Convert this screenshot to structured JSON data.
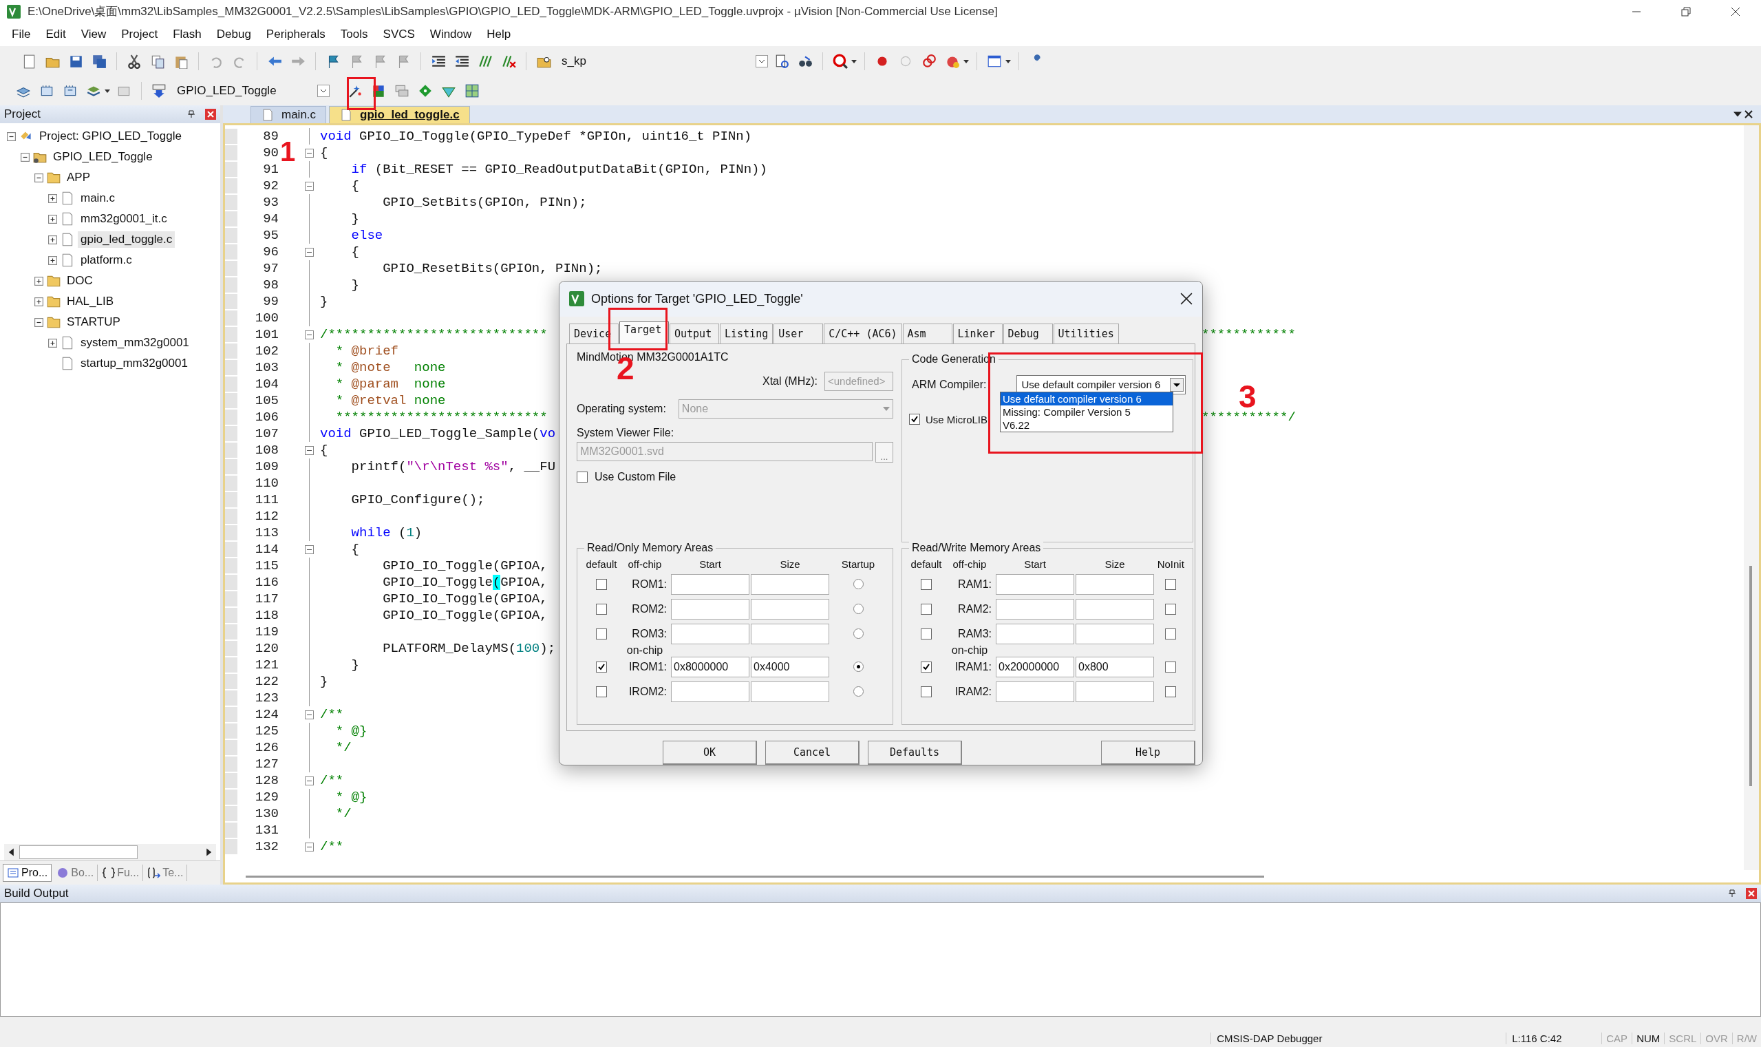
{
  "window": {
    "title": "E:\\OneDrive\\桌面\\mm32\\LibSamples_MM32G0001_V2.2.5\\Samples\\LibSamples\\GPIO\\GPIO_LED_Toggle\\MDK-ARM\\GPIO_LED_Toggle.uvprojx - µVision  [Non-Commercial Use License]"
  },
  "menu": [
    "File",
    "Edit",
    "View",
    "Project",
    "Flash",
    "Debug",
    "Peripherals",
    "Tools",
    "SVCS",
    "Window",
    "Help"
  ],
  "toolbar": {
    "find_combo": "s_kp",
    "target_combo": "GPIO_LED_Toggle"
  },
  "project_panel": {
    "title": "Project",
    "tree": [
      {
        "label": "Project: GPIO_LED_Toggle",
        "kind": "project",
        "expanded": true,
        "selected": false,
        "children": [
          {
            "label": "GPIO_LED_Toggle",
            "kind": "target",
            "expanded": true,
            "selected": false,
            "children": [
              {
                "label": "APP",
                "kind": "folder",
                "expanded": true,
                "selected": false,
                "children": [
                  {
                    "label": "main.c",
                    "kind": "file",
                    "expanded": false,
                    "selected": false
                  },
                  {
                    "label": "mm32g0001_it.c",
                    "kind": "file",
                    "expanded": false,
                    "selected": false
                  },
                  {
                    "label": "gpio_led_toggle.c",
                    "kind": "file",
                    "expanded": false,
                    "selected": true
                  },
                  {
                    "label": "platform.c",
                    "kind": "file",
                    "expanded": false,
                    "selected": false
                  }
                ]
              },
              {
                "label": "DOC",
                "kind": "folder",
                "expanded": false,
                "selected": false
              },
              {
                "label": "HAL_LIB",
                "kind": "folder",
                "expanded": false,
                "selected": false
              },
              {
                "label": "STARTUP",
                "kind": "folder",
                "expanded": true,
                "selected": false,
                "children": [
                  {
                    "label": "system_mm32g0001",
                    "kind": "file",
                    "expanded": false,
                    "selected": false
                  },
                  {
                    "label": "startup_mm32g0001",
                    "kind": "file",
                    "selected": false
                  }
                ]
              }
            ]
          }
        ]
      }
    ],
    "tabs": [
      {
        "label": "Pro...",
        "selected": true
      },
      {
        "label": "Bo...",
        "selected": false
      },
      {
        "label": "Fu...",
        "selected": false
      },
      {
        "label": "Te...",
        "selected": false
      }
    ]
  },
  "editor": {
    "tabs": [
      {
        "label": "main.c",
        "selected": false
      },
      {
        "label": "gpio_led_toggle.c",
        "selected": true
      }
    ],
    "lines": [
      {
        "number": "89",
        "fold": false,
        "tokens": [
          {
            "kind": "keyword",
            "text": "void"
          },
          {
            "text": " GPIO_IO_Toggle(GPIO_TypeDef *GPIOn, uint16_t PINn)"
          }
        ]
      },
      {
        "number": "90",
        "fold": true,
        "tokens": [
          {
            "text": "{"
          }
        ]
      },
      {
        "number": "91",
        "fold": false,
        "tokens": [
          {
            "kind": "keyword",
            "text": "    if"
          },
          {
            "text": " (Bit_RESET == GPIO_ReadOutputDataBit(GPIOn, PINn))"
          }
        ]
      },
      {
        "number": "92",
        "fold": true,
        "tokens": [
          {
            "text": "    {"
          }
        ]
      },
      {
        "number": "93",
        "fold": false,
        "tokens": [
          {
            "text": "        GPIO_SetBits(GPIOn, PINn);"
          }
        ]
      },
      {
        "number": "94",
        "fold": false,
        "tokens": [
          {
            "text": "    }"
          }
        ]
      },
      {
        "number": "95",
        "fold": false,
        "tokens": [
          {
            "kind": "keyword",
            "text": "    else"
          }
        ]
      },
      {
        "number": "96",
        "fold": true,
        "tokens": [
          {
            "text": "    {"
          }
        ]
      },
      {
        "number": "97",
        "fold": false,
        "tokens": [
          {
            "text": "        GPIO_ResetBits(GPIOn, PINn);"
          }
        ]
      },
      {
        "number": "98",
        "fold": false,
        "tokens": [
          {
            "text": "    }"
          }
        ]
      },
      {
        "number": "99",
        "fold": false,
        "tokens": [
          {
            "text": "}"
          }
        ]
      },
      {
        "number": "100",
        "fold": false
      },
      {
        "number": "101",
        "fold": true,
        "tokens": [
          {
            "kind": "comment",
            "text": "/****************************"
          }
        ],
        "tail": "************"
      },
      {
        "number": "102",
        "fold": false,
        "tokens": [
          {
            "kind": "comment",
            "text": "  * "
          },
          {
            "kind": "tag",
            "text": "@brief"
          }
        ]
      },
      {
        "number": "103",
        "fold": false,
        "tokens": [
          {
            "kind": "comment",
            "text": "  * "
          },
          {
            "kind": "tag",
            "text": "@note"
          },
          {
            "kind": "comment",
            "text": "   none"
          }
        ]
      },
      {
        "number": "104",
        "fold": false,
        "tokens": [
          {
            "kind": "comment",
            "text": "  * "
          },
          {
            "kind": "tag",
            "text": "@param"
          },
          {
            "kind": "comment",
            "text": "  none"
          }
        ]
      },
      {
        "number": "105",
        "fold": false,
        "tokens": [
          {
            "kind": "comment",
            "text": "  * "
          },
          {
            "kind": "tag",
            "text": "@retval"
          },
          {
            "kind": "comment",
            "text": " none"
          }
        ]
      },
      {
        "number": "106",
        "fold": false,
        "tokens": [
          {
            "kind": "comment",
            "text": "  ***************************"
          }
        ],
        "tail": "***********/"
      },
      {
        "number": "107",
        "fold": false,
        "tokens": [
          {
            "kind": "keyword",
            "text": "void"
          },
          {
            "text": " GPIO_LED_Toggle_Sample("
          },
          {
            "kind": "keyword",
            "text": "vo"
          }
        ]
      },
      {
        "number": "108",
        "fold": true,
        "tokens": [
          {
            "text": "{"
          }
        ]
      },
      {
        "number": "109",
        "fold": false,
        "tokens": [
          {
            "text": "    printf("
          },
          {
            "kind": "string",
            "text": "\"\\r\\nTest %s\""
          },
          {
            "text": ", __FU"
          }
        ]
      },
      {
        "number": "110",
        "fold": false
      },
      {
        "number": "111",
        "fold": false,
        "tokens": [
          {
            "text": "    GPIO_Configure();"
          }
        ]
      },
      {
        "number": "112",
        "fold": false
      },
      {
        "number": "113",
        "fold": false,
        "tokens": [
          {
            "kind": "keyword",
            "text": "    while"
          },
          {
            "text": " ("
          },
          {
            "kind": "number",
            "text": "1"
          },
          {
            "text": ")"
          }
        ]
      },
      {
        "number": "114",
        "fold": true,
        "tokens": [
          {
            "text": "    {"
          }
        ]
      },
      {
        "number": "115",
        "fold": false,
        "tokens": [
          {
            "text": "        GPIO_IO_Toggle(GPIOA,"
          }
        ]
      },
      {
        "number": "116",
        "fold": false,
        "tokens": [
          {
            "text": "        GPIO_IO_Toggle"
          },
          {
            "kind": "match",
            "text": "("
          },
          {
            "text": "GPIOA,"
          }
        ]
      },
      {
        "number": "117",
        "fold": false,
        "tokens": [
          {
            "text": "        GPIO_IO_Toggle(GPIOA,"
          }
        ]
      },
      {
        "number": "118",
        "fold": false,
        "tokens": [
          {
            "text": "        GPIO_IO_Toggle(GPIOA,"
          }
        ]
      },
      {
        "number": "119",
        "fold": false
      },
      {
        "number": "120",
        "fold": false,
        "tokens": [
          {
            "text": "        PLATFORM_DelayMS("
          },
          {
            "kind": "number",
            "text": "100"
          },
          {
            "text": ");"
          }
        ]
      },
      {
        "number": "121",
        "fold": false,
        "tokens": [
          {
            "text": "    }"
          }
        ]
      },
      {
        "number": "122",
        "fold": false,
        "tokens": [
          {
            "text": "}"
          }
        ]
      },
      {
        "number": "123",
        "fold": false
      },
      {
        "number": "124",
        "fold": true,
        "tokens": [
          {
            "kind": "comment",
            "text": "/**"
          }
        ]
      },
      {
        "number": "125",
        "fold": false,
        "tokens": [
          {
            "kind": "comment",
            "text": "  * @}"
          }
        ]
      },
      {
        "number": "126",
        "fold": false,
        "tokens": [
          {
            "kind": "comment",
            "text": "  */"
          }
        ]
      },
      {
        "number": "127",
        "fold": false
      },
      {
        "number": "128",
        "fold": true,
        "tokens": [
          {
            "kind": "comment",
            "text": "/**"
          }
        ]
      },
      {
        "number": "129",
        "fold": false,
        "tokens": [
          {
            "kind": "comment",
            "text": "  * @}"
          }
        ]
      },
      {
        "number": "130",
        "fold": false,
        "tokens": [
          {
            "kind": "comment",
            "text": "  */"
          }
        ]
      },
      {
        "number": "131",
        "fold": false
      },
      {
        "number": "132",
        "fold": true,
        "tokens": [
          {
            "kind": "comment",
            "text": "/**"
          }
        ]
      }
    ]
  },
  "dialog": {
    "title": "Options for Target 'GPIO_LED_Toggle'",
    "tabs": [
      {
        "label": "Device",
        "selected": false
      },
      {
        "label": "Target",
        "selected": true
      },
      {
        "label": "Output",
        "selected": false
      },
      {
        "label": "Listing",
        "selected": false
      },
      {
        "label": "User",
        "selected": false
      },
      {
        "label": "C/C++ (AC6)",
        "selected": false
      },
      {
        "label": "Asm",
        "selected": false
      },
      {
        "label": "Linker",
        "selected": false
      },
      {
        "label": "Debug",
        "selected": false
      },
      {
        "label": "Utilities",
        "selected": false
      }
    ],
    "device": "MindMotion MM32G0001A1TC",
    "xtal": {
      "label": "Xtal (MHz):",
      "value": "<undefined>"
    },
    "os": {
      "label": "Operating system:",
      "value": "None"
    },
    "svd": {
      "label": "System Viewer File:",
      "value": "MM32G0001.svd",
      "browse": "..."
    },
    "custom_file": {
      "label": "Use Custom File",
      "checked": false
    },
    "code_gen": {
      "title": "Code Generation",
      "compiler_label": "ARM Compiler:",
      "compiler_value": "Use default compiler version 6",
      "options": [
        {
          "label": "Use default compiler version 6",
          "selected": true
        },
        {
          "label": "Missing: Compiler Version 5",
          "selected": false
        },
        {
          "label": "V6.22",
          "selected": false
        }
      ],
      "microlib": {
        "label": "Use MicroLIB",
        "checked": true
      }
    },
    "rom": {
      "title": "Read/Only Memory Areas",
      "headers": [
        "default",
        "off-chip",
        "Start",
        "Size",
        "Startup"
      ],
      "rows": [
        {
          "kind": "area",
          "label": "ROM1:",
          "default": false,
          "option": false
        },
        {
          "kind": "area",
          "label": "ROM2:",
          "default": false,
          "option": false
        },
        {
          "kind": "area",
          "label": "ROM3:",
          "default": false,
          "option": false
        },
        {
          "kind": "caption",
          "label": "on-chip"
        },
        {
          "kind": "area",
          "label": "IROM1:",
          "default": true,
          "start": "0x8000000",
          "size": "0x4000",
          "option": true
        },
        {
          "kind": "area",
          "label": "IROM2:",
          "default": false,
          "option": false
        }
      ]
    },
    "ram": {
      "title": "Read/Write Memory Areas",
      "headers": [
        "default",
        "off-chip",
        "Start",
        "Size",
        "NoInit"
      ],
      "rows": [
        {
          "kind": "area",
          "label": "RAM1:",
          "default": false,
          "option": false
        },
        {
          "kind": "area",
          "label": "RAM2:",
          "default": false,
          "option": false
        },
        {
          "kind": "area",
          "label": "RAM3:",
          "default": false,
          "option": false
        },
        {
          "kind": "caption",
          "label": "on-chip"
        },
        {
          "kind": "area",
          "label": "IRAM1:",
          "default": true,
          "start": "0x20000000",
          "size": "0x800",
          "option": false
        },
        {
          "kind": "area",
          "label": "IRAM2:",
          "default": false,
          "option": false
        }
      ]
    },
    "buttons": [
      "OK",
      "Cancel",
      "Defaults",
      "Help"
    ]
  },
  "annotations": [
    "1",
    "2",
    "3"
  ],
  "build_output": {
    "title": "Build Output"
  },
  "status_bar": {
    "debugger": "CMSIS-DAP Debugger",
    "position": "L:116 C:42",
    "indicators": [
      {
        "label": "CAP",
        "on": false
      },
      {
        "label": "NUM",
        "on": true
      },
      {
        "label": "SCRL",
        "on": false
      },
      {
        "label": "OVR",
        "on": false
      },
      {
        "label": "R/W",
        "on": false
      }
    ]
  }
}
